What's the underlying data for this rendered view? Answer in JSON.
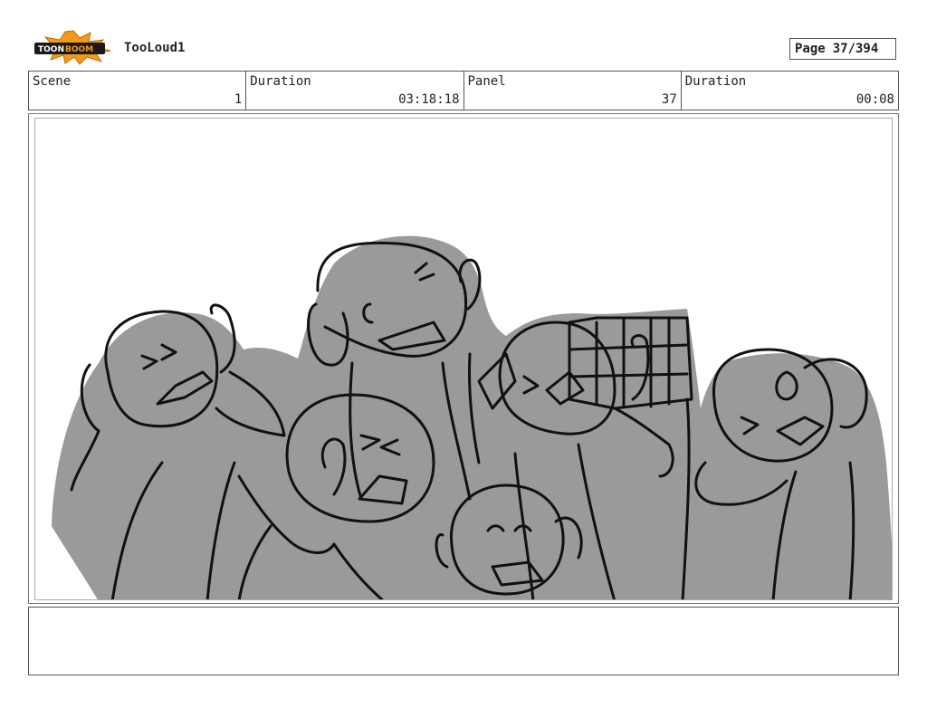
{
  "header": {
    "project_name": "TooLoud1",
    "page_label": "Page",
    "page_value": "37/394",
    "logo_icon": "toonboom-logo-icon"
  },
  "info": {
    "scene_label": "Scene",
    "scene_value": "1",
    "duration_label": "Duration",
    "duration_value": "03:18:18",
    "panel_label": "Panel",
    "panel_value": "37",
    "panel_duration_label": "Duration",
    "panel_duration_value": "00:08"
  },
  "panel": {
    "drawing": "storyboard-sketch-crowd-covering-ears",
    "fill_color": "#9a9a9a",
    "line_color": "#111111"
  },
  "notes": {
    "text": ""
  }
}
